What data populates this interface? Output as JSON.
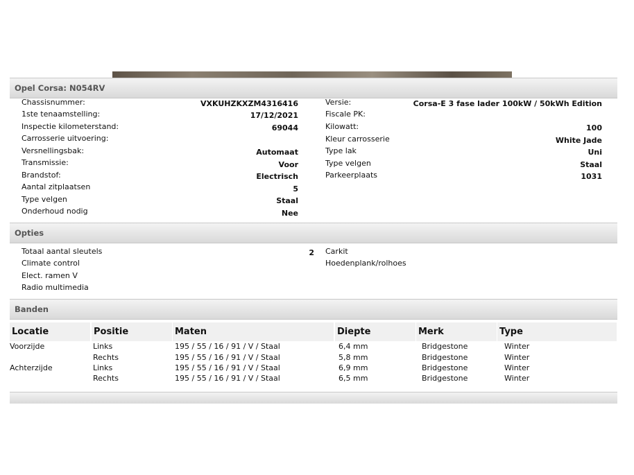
{
  "vehicle": {
    "section_title": "Opel Corsa: N054RV",
    "left": [
      {
        "label": "Chassisnummer:",
        "value": "VXKUHZKXZM4316416"
      },
      {
        "label": "1ste tenaamstelling:",
        "value": "17/12/2021"
      },
      {
        "label": "Inspectie kilometerstand:",
        "value": "69044"
      },
      {
        "label": "Carrosserie uitvoering:",
        "value": ""
      },
      {
        "label": "Versnellingsbak:",
        "value": "Automaat"
      },
      {
        "label": "Transmissie:",
        "value": "Voor"
      },
      {
        "label": "Brandstof:",
        "value": "Electrisch"
      },
      {
        "label": "Aantal zitplaatsen",
        "value": "5"
      },
      {
        "label": "Type velgen",
        "value": "Staal"
      },
      {
        "label": "Onderhoud nodig",
        "value": "Nee"
      }
    ],
    "right": [
      {
        "label": "Versie:",
        "value": "Corsa-E 3 fase lader 100kW / 50kWh Edition"
      },
      {
        "label": "Fiscale PK:",
        "value": ""
      },
      {
        "label": "Kilowatt:",
        "value": "100"
      },
      {
        "label": "Kleur carrosserie",
        "value": "White Jade"
      },
      {
        "label": "Type lak",
        "value": "Uni"
      },
      {
        "label": "Type velgen",
        "value": "Staal"
      },
      {
        "label": "Parkeerplaats",
        "value": "1031"
      }
    ]
  },
  "options": {
    "section_title": "Opties",
    "left": [
      {
        "label": "Totaal aantal sleutels",
        "value": "2"
      },
      {
        "label": "Climate control",
        "value": ""
      },
      {
        "label": "Elect. ramen V",
        "value": ""
      },
      {
        "label": "Radio multimedia",
        "value": ""
      }
    ],
    "right": [
      {
        "label": "Carkit"
      },
      {
        "label": "Hoedenplank/rolhoes"
      }
    ]
  },
  "tires": {
    "section_title": "Banden",
    "headers": [
      "Locatie",
      "Positie",
      "Maten",
      "Diepte",
      "Merk",
      "Type"
    ],
    "rows": [
      [
        "Voorzijde",
        "Links",
        "195 / 55 / 16 / 91 / V / Staal",
        "6,4 mm",
        "Bridgestone",
        "Winter"
      ],
      [
        "",
        "Rechts",
        "195 / 55 / 16 / 91 / V / Staal",
        "5,8 mm",
        "Bridgestone",
        "Winter"
      ],
      [
        "Achterzijde",
        "Links",
        "195 / 55 / 16 / 91 / V / Staal",
        "6,9 mm",
        "Bridgestone",
        "Winter"
      ],
      [
        "",
        "Rechts",
        "195 / 55 / 16 / 91 / V / Staal",
        "6,5 mm",
        "Bridgestone",
        "Winter"
      ]
    ]
  }
}
